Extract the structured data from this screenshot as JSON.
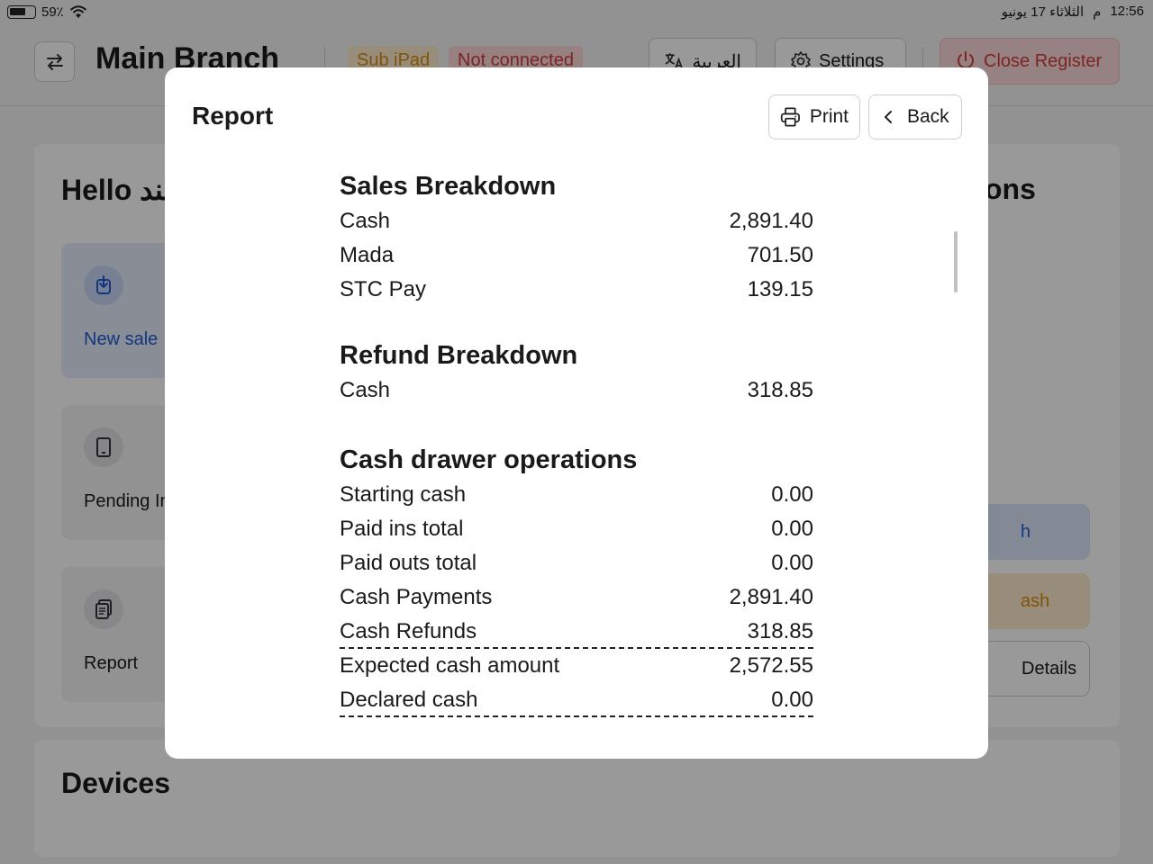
{
  "status_bar": {
    "battery": "59٪",
    "time": "12:56",
    "ampm": "م",
    "date": "الثلاثاء 17 يونيو"
  },
  "header": {
    "branch_name": "Main Branch",
    "badge_sub": "Sub iPad",
    "badge_connection": "Not connected",
    "language_button": "العربية",
    "settings_button": "Settings",
    "close_register_button": "Close Register"
  },
  "page": {
    "greeting": "Hello هند",
    "actions_title": "ons",
    "tiles": [
      {
        "label": "New sale"
      },
      {
        "label": "Pending In"
      },
      {
        "label": "Report"
      }
    ],
    "right_buttons": {
      "pay": "h",
      "cash": "ash",
      "details": "Details"
    },
    "devices_title": "Devices"
  },
  "modal": {
    "title": "Report",
    "print_button": "Print",
    "back_button": "Back",
    "sales_breakdown": {
      "title": "Sales Breakdown",
      "rows": [
        {
          "label": "Cash",
          "value": "2,891.40"
        },
        {
          "label": "Mada",
          "value": "701.50"
        },
        {
          "label": "STC Pay",
          "value": "139.15"
        }
      ]
    },
    "refund_breakdown": {
      "title": "Refund Breakdown",
      "rows": [
        {
          "label": "Cash",
          "value": "318.85"
        }
      ]
    },
    "cash_drawer": {
      "title": "Cash drawer operations",
      "rows": [
        {
          "label": "Starting cash",
          "value": "0.00"
        },
        {
          "label": "Paid ins total",
          "value": "0.00"
        },
        {
          "label": "Paid outs total",
          "value": "0.00"
        },
        {
          "label": "Cash Payments",
          "value": "2,891.40"
        },
        {
          "label": "Cash Refunds",
          "value": "318.85"
        },
        {
          "label": "Expected cash amount",
          "value": "2,572.55"
        },
        {
          "label": "Declared cash",
          "value": "0.00"
        }
      ]
    }
  },
  "colors": {
    "accent_blue": "#1f5bd6",
    "warning_orange": "#d68a10",
    "danger_red": "#d13b3b"
  }
}
